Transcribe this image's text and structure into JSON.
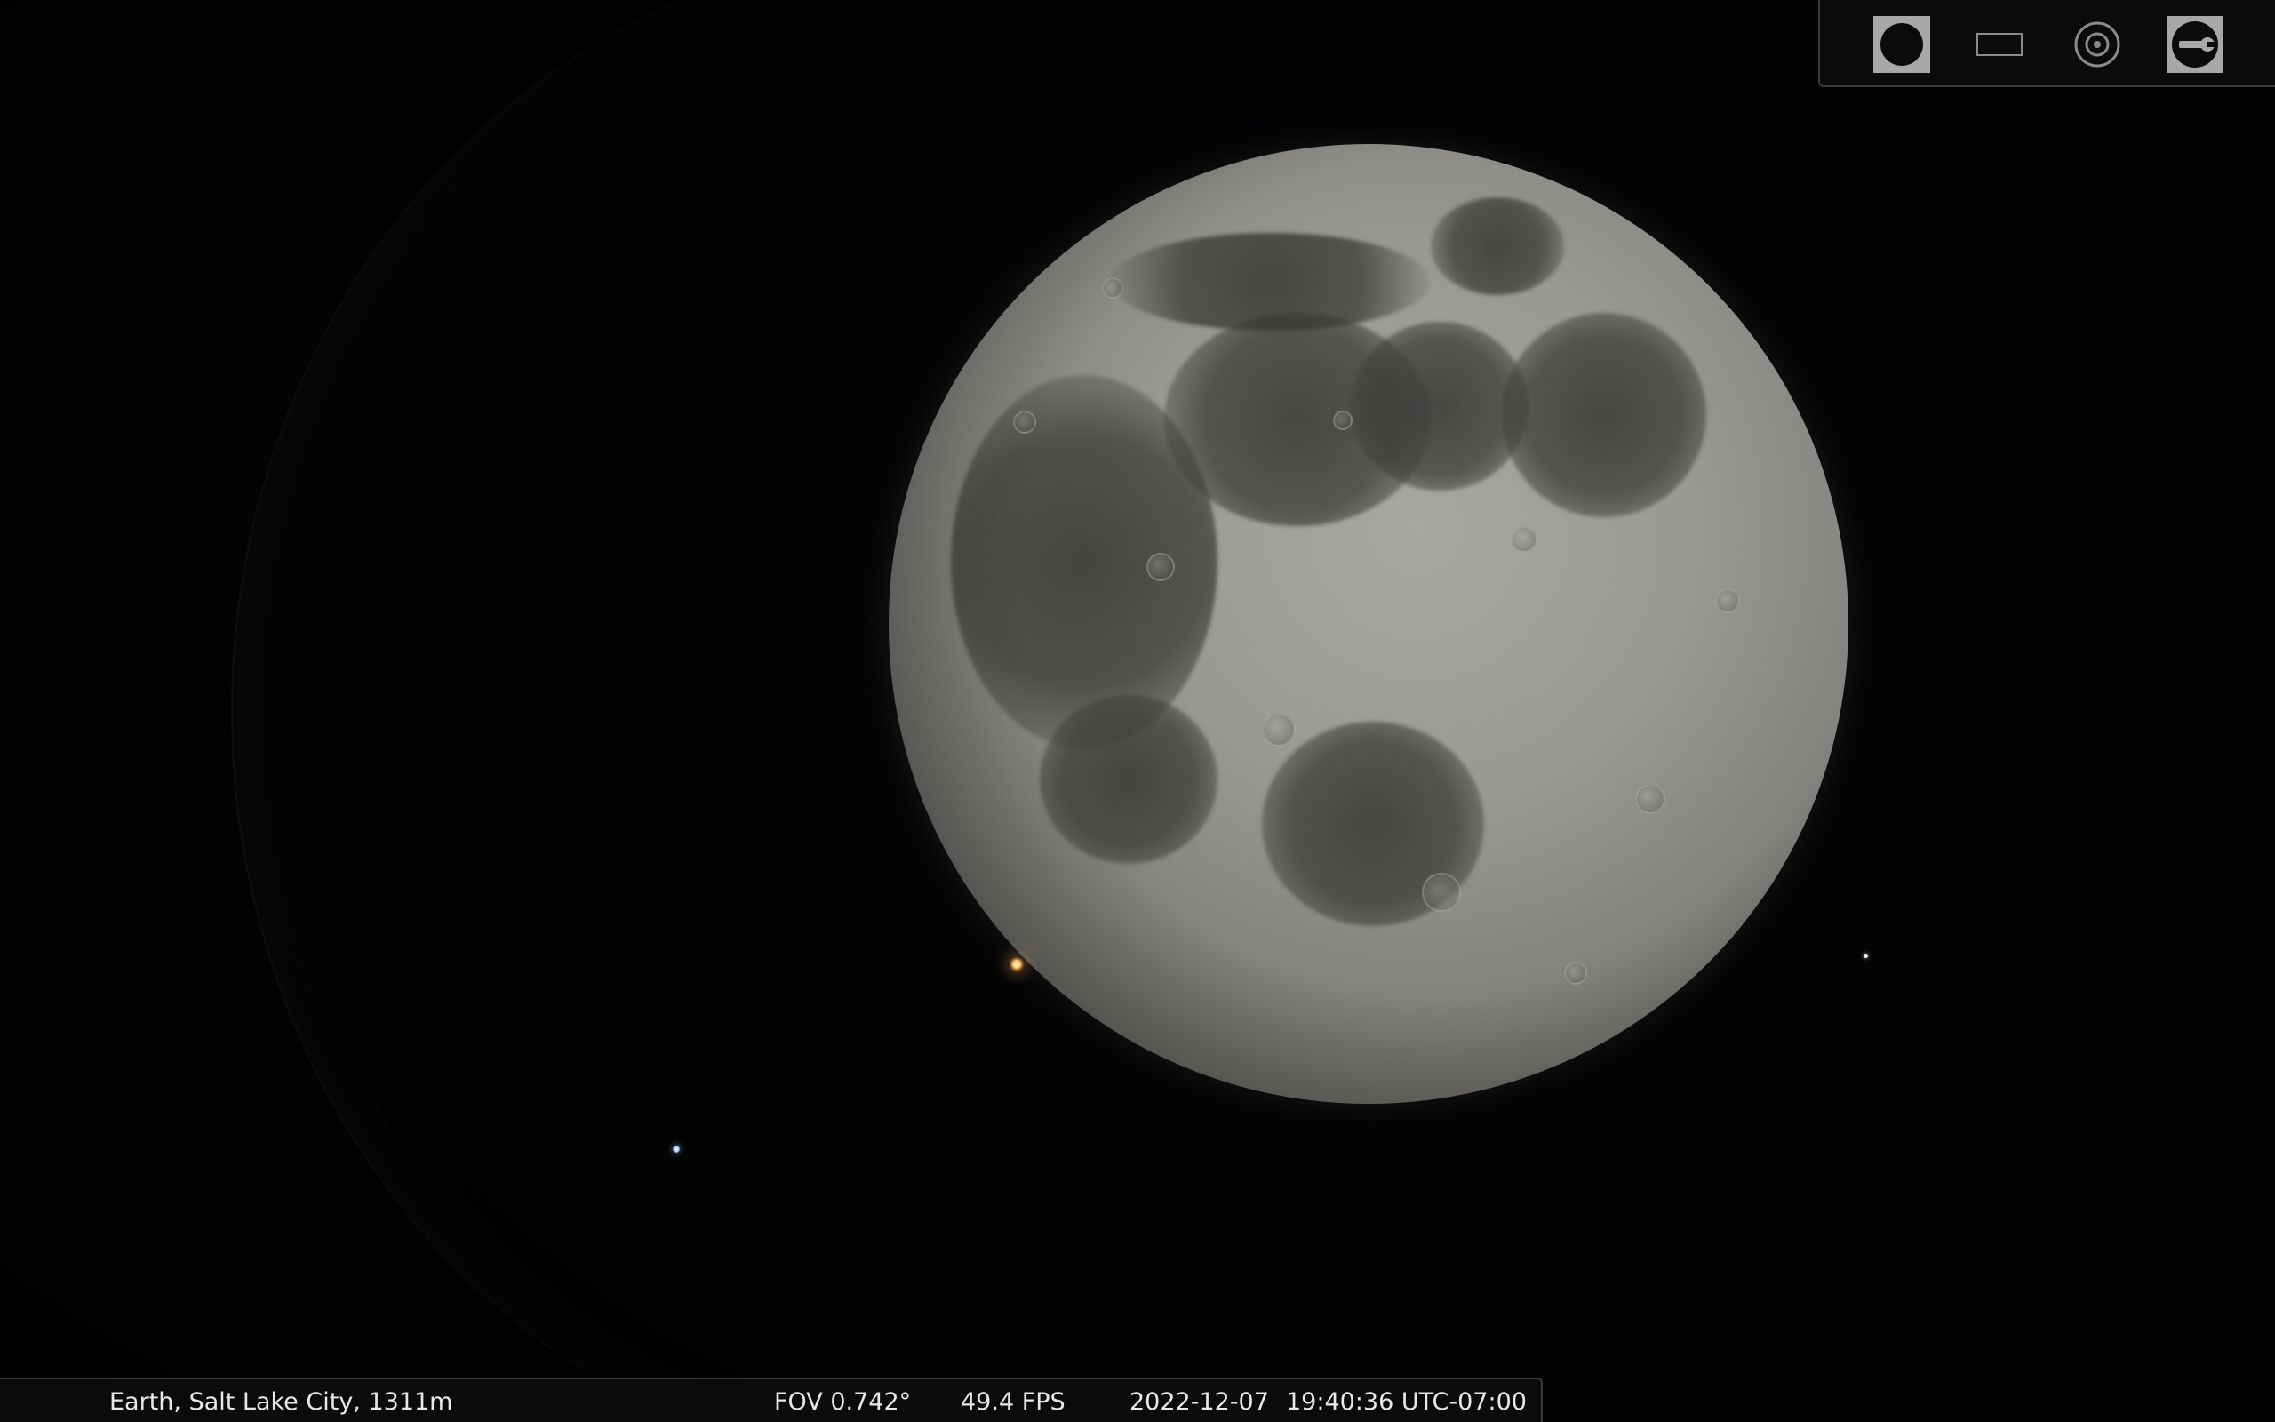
{
  "toolbar": {
    "buttons": [
      {
        "name": "night-mode",
        "icon": "filled-circle-icon",
        "active": true
      },
      {
        "name": "fullscreen",
        "icon": "rectangle-icon",
        "active": false
      },
      {
        "name": "view-reset",
        "icon": "target-icon",
        "active": false
      },
      {
        "name": "quit",
        "icon": "wrench-icon",
        "active": true
      }
    ]
  },
  "status": {
    "location": "Earth, Salt Lake City, 1311m",
    "fov": "FOV 0.742°",
    "fps": "49.4 FPS",
    "date": "2022-12-07",
    "time": "19:40:36 UTC-07:00"
  },
  "colors": {
    "sky": "#020203",
    "bar_bg": "#0b0b0b",
    "bar_border": "#3a3a3a",
    "text": "#e8e8e8",
    "active_button": "#a8a8a8"
  }
}
